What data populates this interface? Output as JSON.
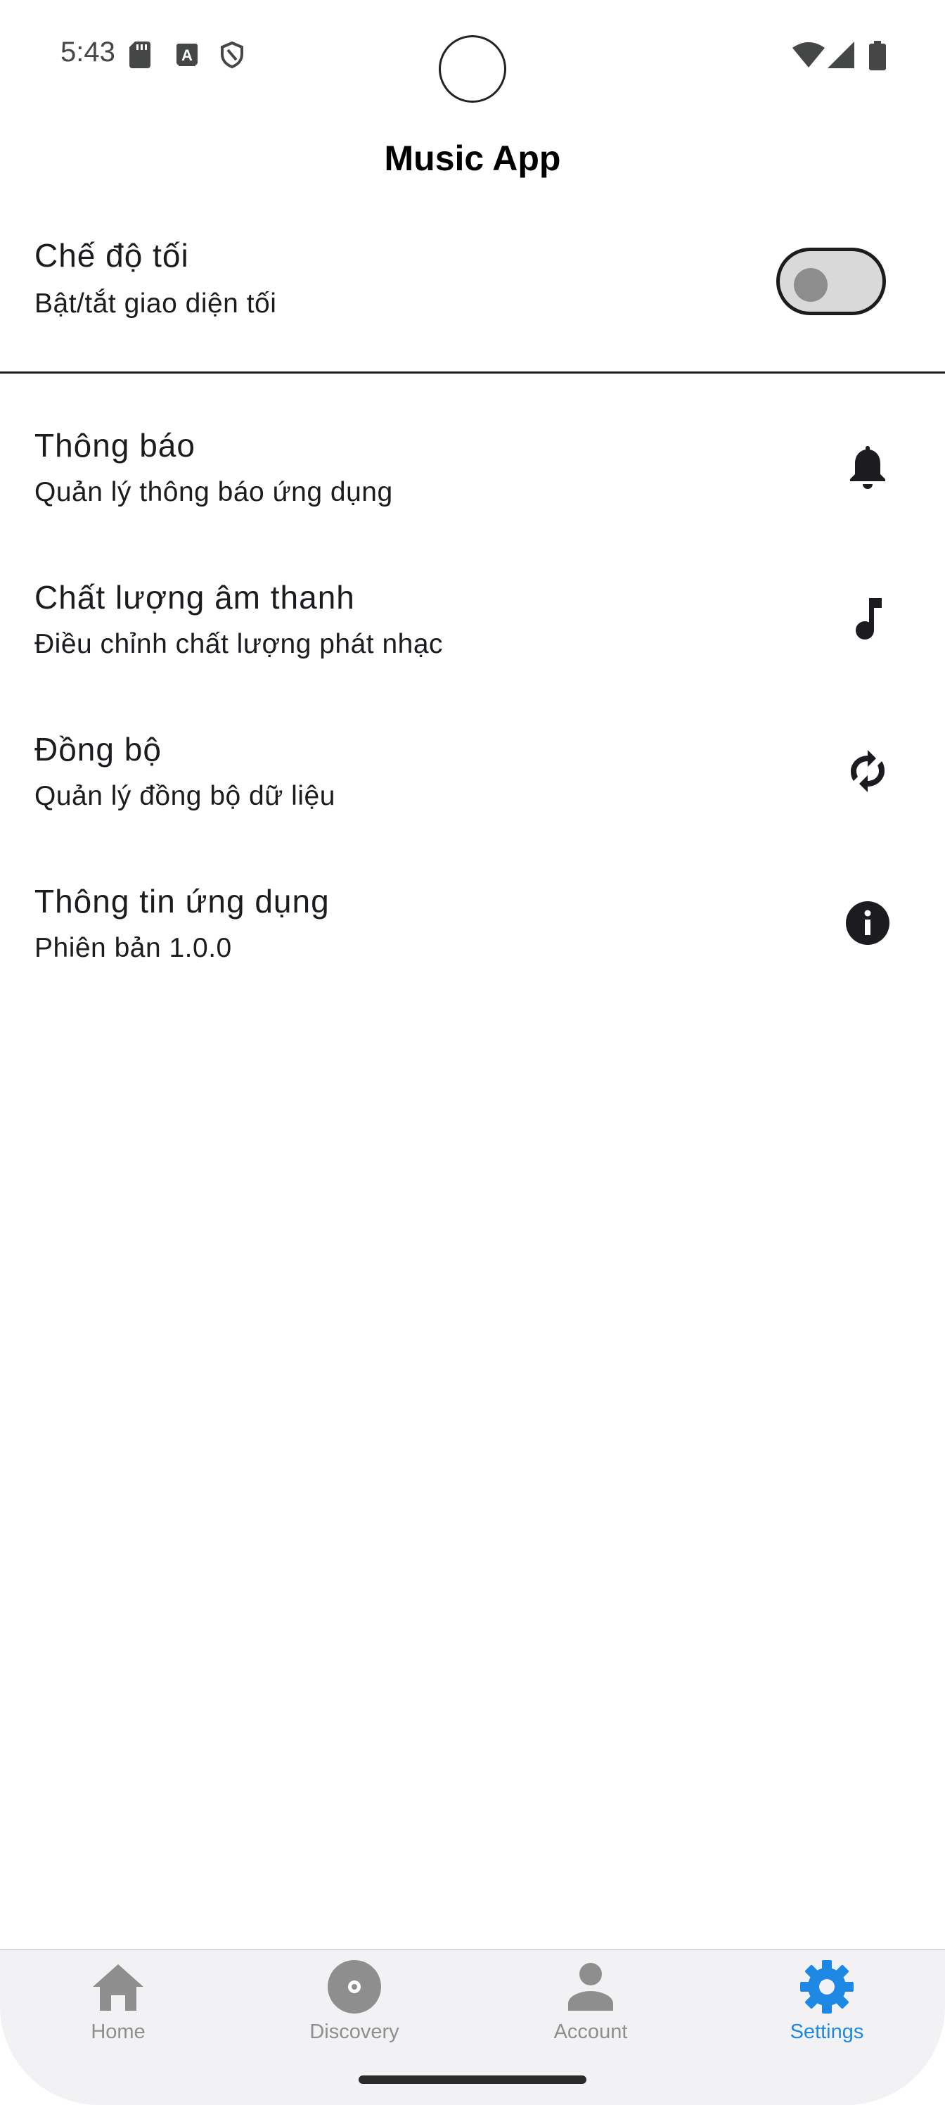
{
  "status_bar": {
    "time": "5:43",
    "left_icons": [
      "sd-card-icon",
      "text-a-icon",
      "shield-icon"
    ],
    "right_icons": [
      "wifi-icon",
      "signal-icon",
      "battery-icon"
    ]
  },
  "app_bar": {
    "title": "Music App"
  },
  "settings": {
    "dark_mode": {
      "title": "Chế độ tối",
      "subtitle": "Bật/tắt giao diện tối",
      "enabled": false
    },
    "items": [
      {
        "title": "Thông báo",
        "subtitle": "Quản lý thông báo ứng dụng",
        "icon": "bell-icon"
      },
      {
        "title": "Chất lượng âm thanh",
        "subtitle": "Điều chỉnh chất lượng phát nhạc",
        "icon": "music-note-icon"
      },
      {
        "title": "Đồng bộ",
        "subtitle": "Quản lý đồng bộ dữ liệu",
        "icon": "sync-icon"
      },
      {
        "title": "Thông tin ứng dụng",
        "subtitle": "Phiên bản 1.0.0",
        "icon": "info-icon"
      }
    ]
  },
  "bottom_nav": {
    "items": [
      {
        "label": "Home",
        "icon": "home-icon",
        "active": false
      },
      {
        "label": "Discovery",
        "icon": "disc-icon",
        "active": false
      },
      {
        "label": "Account",
        "icon": "person-icon",
        "active": false
      },
      {
        "label": "Settings",
        "icon": "gear-icon",
        "active": true
      }
    ]
  },
  "colors": {
    "active": "#1e88e5",
    "inactive": "#8e8e8e",
    "text": "#1c1b1f",
    "nav_background": "#f2f2f4"
  }
}
